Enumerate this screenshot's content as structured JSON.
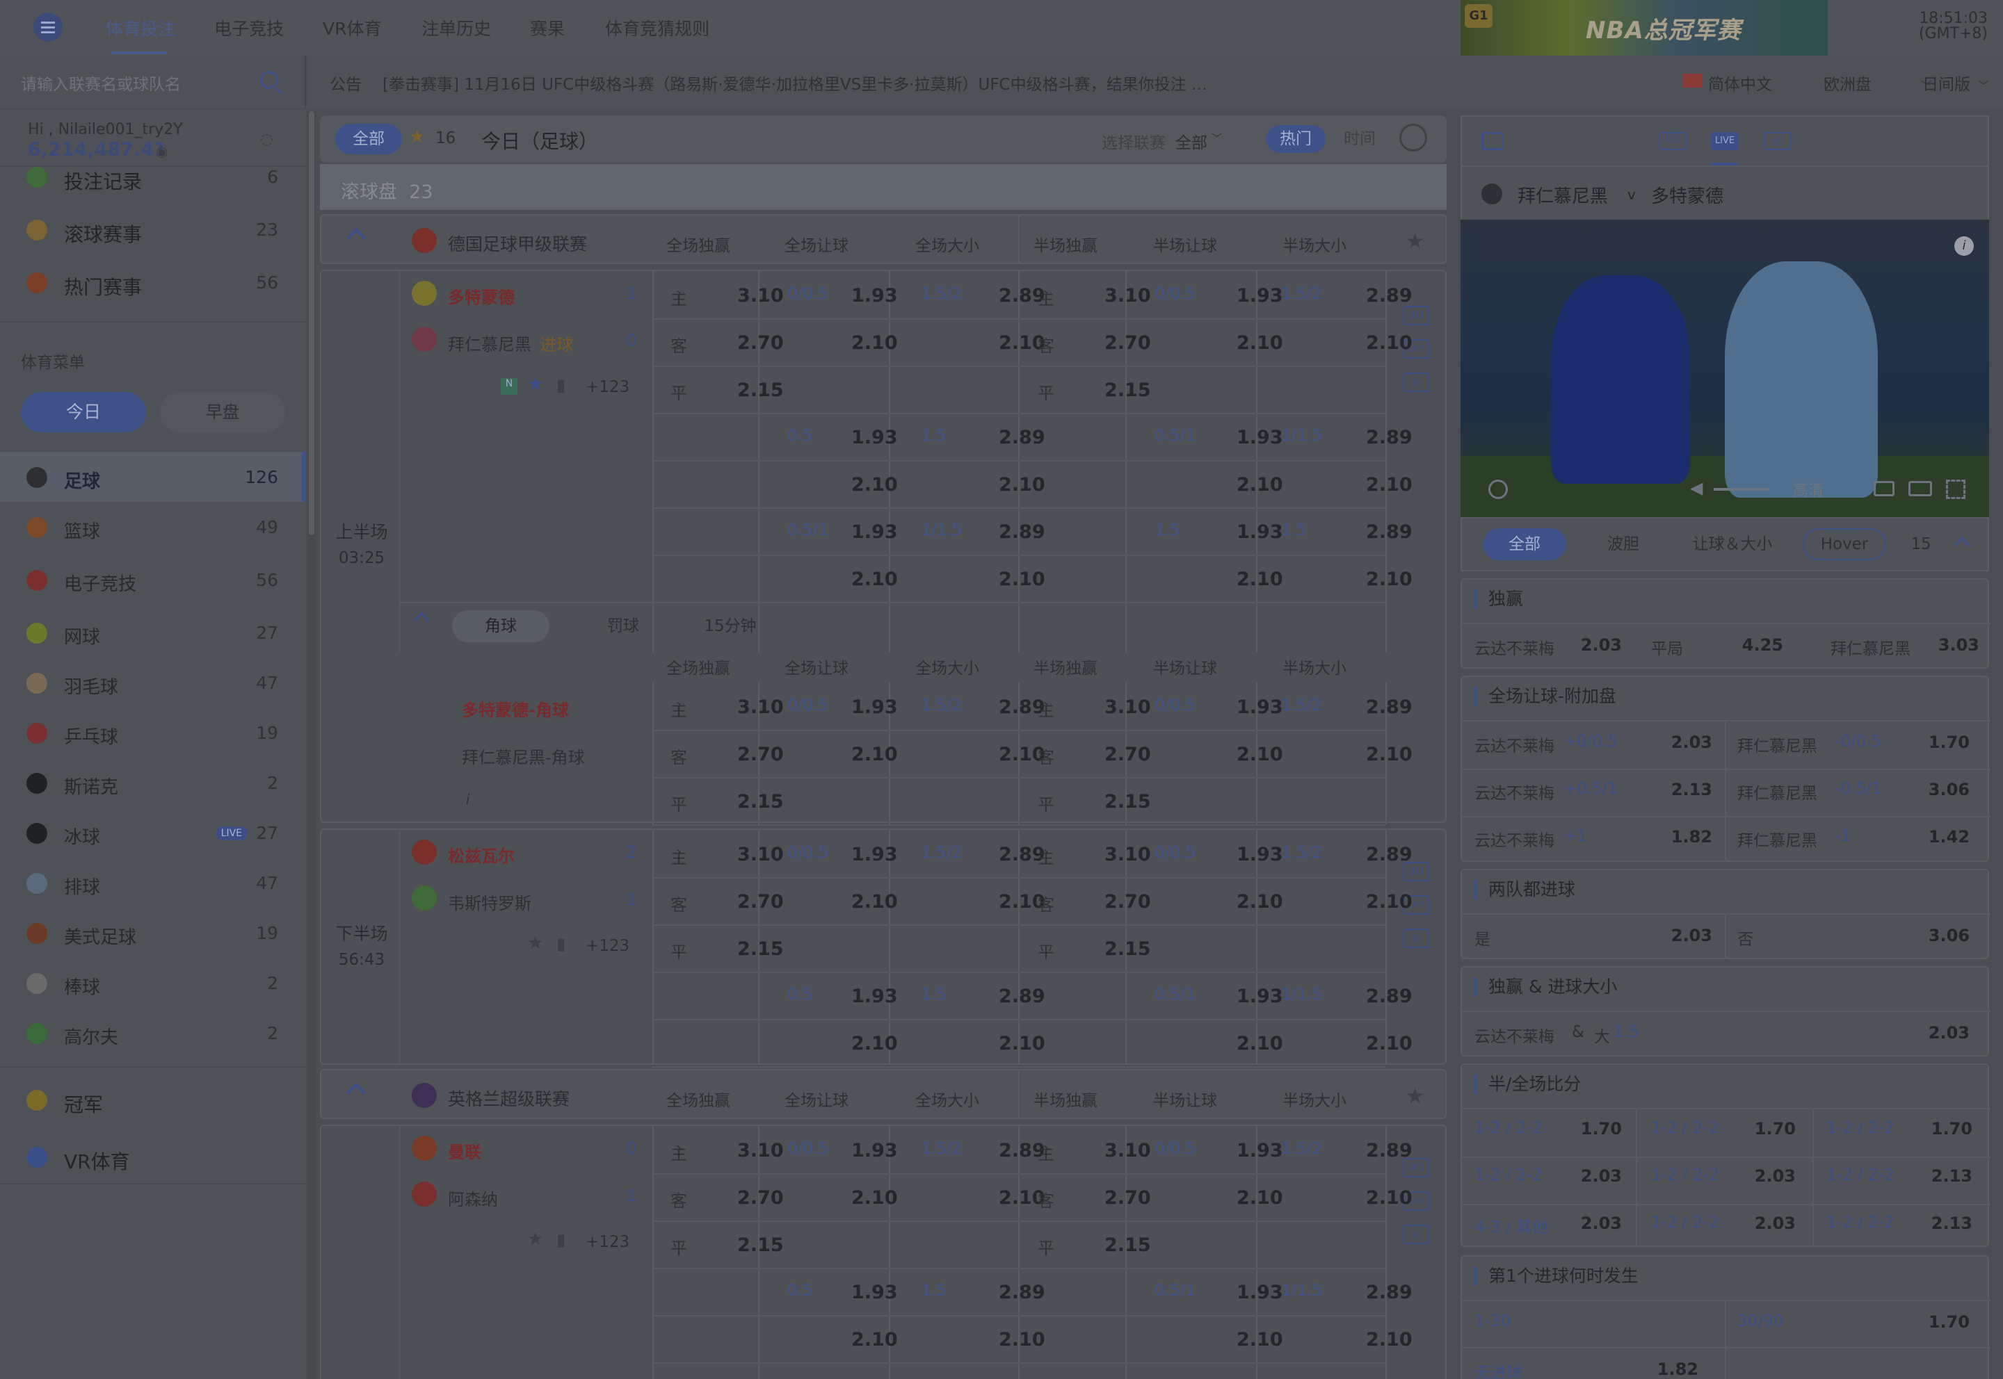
{
  "header": {
    "nav": [
      "体育投注",
      "电子竞技",
      "VR体育",
      "注单历史",
      "赛果",
      "体育竞猜规则"
    ],
    "banner_text": "NBA总冠军赛",
    "banner_badge": "G1",
    "time": "18:51:03",
    "timezone": "(GMT+8)"
  },
  "search": {
    "placeholder": "请输入联赛名或球队名"
  },
  "announcement": {
    "label": "公告",
    "text": "[拳击赛事] 11月16日 UFC中级格斗赛（路易斯·爱德华·加拉格里VS里卡多·拉莫斯）UFC中级格斗赛，结果你投注 …",
    "language": "简体中文",
    "odds_type": "欧洲盘",
    "theme": "日间版"
  },
  "user": {
    "greeting": "Hi , Nilaile001_try2Y",
    "balance": "6,214,487.41"
  },
  "sidebar": {
    "top": [
      {
        "label": "投注记录",
        "count": "6",
        "icon": "bet-record-icon",
        "color": "#3f6a3a"
      },
      {
        "label": "滚球赛事",
        "count": "23",
        "icon": "live-ball-icon",
        "color": "#7a6334"
      },
      {
        "label": "热门赛事",
        "count": "56",
        "icon": "fire-icon",
        "color": "#7a3e28"
      }
    ],
    "menu_title": "体育菜单",
    "toggle": [
      "今日",
      "早盘"
    ],
    "sports": [
      {
        "label": "足球",
        "count": "126",
        "icon": "soccer-icon",
        "color": "#2d2f33"
      },
      {
        "label": "篮球",
        "count": "49",
        "icon": "basketball-icon",
        "color": "#7a4a2a"
      },
      {
        "label": "电子竞技",
        "count": "56",
        "icon": "gamepad-icon",
        "color": "#7a2f2f"
      },
      {
        "label": "网球",
        "count": "27",
        "icon": "tennis-icon",
        "color": "#6b7a2a"
      },
      {
        "label": "羽毛球",
        "count": "47",
        "icon": "badminton-icon",
        "color": "#7a6a55"
      },
      {
        "label": "乒乓球",
        "count": "19",
        "icon": "pingpong-icon",
        "color": "#7a2f33"
      },
      {
        "label": "斯诺克",
        "count": "2",
        "icon": "snooker-icon",
        "color": "#1f2124"
      },
      {
        "label": "冰球",
        "count": "27",
        "icon": "hockey-icon",
        "color": "#1f2124",
        "badge": "LIVE"
      },
      {
        "label": "排球",
        "count": "47",
        "icon": "volleyball-icon",
        "color": "#5a6a7a"
      },
      {
        "label": "美式足球",
        "count": "19",
        "icon": "american-football-icon",
        "color": "#6a3a26"
      },
      {
        "label": "棒球",
        "count": "2",
        "icon": "baseball-icon",
        "color": "#6a6a6a"
      },
      {
        "label": "高尔夫",
        "count": "2",
        "icon": "golf-icon",
        "color": "#3a6a3a"
      }
    ],
    "bottom": [
      {
        "label": "冠军",
        "icon": "trophy-icon",
        "color": "#7a6a2a"
      },
      {
        "label": "VR体育",
        "icon": "vr-icon",
        "color": "#3a4e88"
      }
    ]
  },
  "filter": {
    "all": "全部",
    "fav_count": "16",
    "title": "今日（足球）",
    "league_label": "选择联赛",
    "league_value": "全部",
    "hot": "热门",
    "time": "时间"
  },
  "rolling": {
    "label": "滚球盘",
    "count": "23"
  },
  "columns": [
    "全场独赢",
    "全场让球",
    "全场大小",
    "半场独赢",
    "半场让球",
    "半场大小"
  ],
  "leagues": [
    {
      "name": "德国足球甲级联赛",
      "match": {
        "period": "上半场",
        "clock": "03:25",
        "home": "多特蒙德",
        "home_score": "1",
        "away": "拜仁慕尼黑",
        "away_score": "0",
        "away_note": "进球",
        "more": "+123",
        "rows": [
          [
            "主",
            "3.10",
            "0/0.5",
            "1.93",
            "1.5/2",
            "2.89",
            "主",
            "3.10",
            "0/0.5",
            "1.93",
            "1.5/2",
            "2.89"
          ],
          [
            "客",
            "2.70",
            "",
            "2.10",
            "",
            "2.10",
            "客",
            "2.70",
            "",
            "2.10",
            "",
            "2.10"
          ],
          [
            "平",
            "2.15",
            "",
            "",
            "",
            "",
            "平",
            "2.15",
            "",
            "",
            "",
            ""
          ],
          [
            "",
            "",
            "0.5",
            "1.93",
            "1.5",
            "2.89",
            "",
            "",
            "0.5/1",
            "1.93",
            "1/1.5",
            "2.89"
          ],
          [
            "",
            "",
            "",
            "2.10",
            "",
            "2.10",
            "",
            "",
            "",
            "2.10",
            "",
            "2.10"
          ],
          [
            "",
            "",
            "0.5/1",
            "1.93",
            "1/1.5",
            "2.89",
            "",
            "",
            "1.5",
            "1.93",
            "1.5",
            "2.89"
          ],
          [
            "",
            "",
            "",
            "2.10",
            "",
            "2.10",
            "",
            "",
            "",
            "2.10",
            "",
            "2.10"
          ]
        ],
        "subtabs": [
          "角球",
          "罚球",
          "15分钟"
        ],
        "corner_home": "多特蒙德-角球",
        "corner_away": "拜仁慕尼黑-角球",
        "corner_rows": [
          [
            "主",
            "3.10",
            "0/0.5",
            "1.93",
            "1.5/2",
            "2.89",
            "主",
            "3.10",
            "0/0.5",
            "1.93",
            "1.5/2",
            "2.89"
          ],
          [
            "客",
            "2.70",
            "",
            "2.10",
            "",
            "2.10",
            "客",
            "2.70",
            "",
            "2.10",
            "",
            "2.10"
          ],
          [
            "平",
            "2.15",
            "",
            "",
            "",
            "",
            "平",
            "2.15",
            "",
            "",
            "",
            ""
          ]
        ]
      },
      "match2": {
        "period": "下半场",
        "clock": "56:43",
        "home": "松兹瓦尔",
        "home_score": "2",
        "away": "韦斯特罗斯",
        "away_score": "1",
        "more": "+123",
        "rows": [
          [
            "主",
            "3.10",
            "0/0.5",
            "1.93",
            "1.5/2",
            "2.89",
            "主",
            "3.10",
            "0/0.5",
            "1.93",
            "1.5/2",
            "2.89"
          ],
          [
            "客",
            "2.70",
            "",
            "2.10",
            "",
            "2.10",
            "客",
            "2.70",
            "",
            "2.10",
            "",
            "2.10"
          ],
          [
            "平",
            "2.15",
            "",
            "",
            "",
            "",
            "平",
            "2.15",
            "",
            "",
            "",
            ""
          ],
          [
            "",
            "",
            "0.5",
            "1.93",
            "1.5",
            "2.89",
            "",
            "",
            "0.5/1",
            "1.93",
            "1/1.5",
            "2.89"
          ],
          [
            "",
            "",
            "",
            "2.10",
            "",
            "2.10",
            "",
            "",
            "",
            "2.10",
            "",
            "2.10"
          ]
        ]
      }
    },
    {
      "name": "英格兰超级联赛",
      "match": {
        "home": "曼联",
        "home_score": "0",
        "away": "阿森纳",
        "away_score": "1",
        "more": "+123",
        "rows": [
          [
            "主",
            "3.10",
            "0/0.5",
            "1.93",
            "1.5/2",
            "2.89",
            "主",
            "3.10",
            "0/0.5",
            "1.93",
            "1.5/2",
            "2.89"
          ],
          [
            "客",
            "2.70",
            "",
            "2.10",
            "",
            "2.10",
            "客",
            "2.70",
            "",
            "2.10",
            "",
            "2.10"
          ],
          [
            "平",
            "2.15",
            "",
            "",
            "",
            "",
            "平",
            "2.15",
            "",
            "",
            "",
            ""
          ],
          [
            "",
            "",
            "0.5",
            "1.93",
            "1.5",
            "2.89",
            "",
            "",
            "0.5/1",
            "1.93",
            "1/1.5",
            "2.89"
          ],
          [
            "",
            "",
            "",
            "2.10",
            "",
            "2.10",
            "",
            "",
            "",
            "2.10",
            "",
            "2.10"
          ]
        ]
      }
    }
  ],
  "right": {
    "match_home": "拜仁慕尼黑",
    "match_away": "多特蒙德",
    "vs": "v",
    "video_quality": "高清",
    "tabs": [
      "全部",
      "波胆",
      "让球＆大小",
      "Hover",
      "15"
    ],
    "cards": {
      "c1": {
        "title": "独赢",
        "items": [
          [
            "云达不莱梅",
            "2.03"
          ],
          [
            "平局",
            "4.25"
          ],
          [
            "拜仁慕尼黑",
            "3.03"
          ]
        ]
      },
      "c2": {
        "title": "全场让球-附加盘",
        "rows": [
          [
            "云达不莱梅",
            "+0/0.5",
            "2.03",
            "拜仁慕尼黑",
            "-0/0.5",
            "1.70"
          ],
          [
            "云达不莱梅",
            "+0.5/1",
            "2.13",
            "拜仁慕尼黑",
            "-0.5/1",
            "3.06"
          ],
          [
            "云达不莱梅",
            "+1",
            "1.82",
            "拜仁慕尼黑",
            "-1",
            "1.42"
          ]
        ]
      },
      "c3": {
        "title": "两队都进球",
        "items": [
          [
            "是",
            "2.03"
          ],
          [
            "否",
            "3.06"
          ]
        ]
      },
      "c4": {
        "title": "独赢 & 进球大小",
        "label": "云达不莱梅",
        "amp": "&",
        "size": "大",
        "line": "1.5",
        "value": "2.03"
      },
      "c5": {
        "title": "半/全场比分",
        "rows": [
          [
            "1-2 / 2-2",
            "1.70",
            "1-2 / 2-2",
            "1.70",
            "1-2 / 2-2",
            "1.70"
          ],
          [
            "1-2 / 2-2",
            "2.03",
            "1-2 / 2-2",
            "2.03",
            "1-2 / 2-2",
            "2.13"
          ],
          [
            "4-3 / 其他",
            "2.03",
            "1-2 / 2-2",
            "2.03",
            "1-2 / 2-2",
            "2.13"
          ]
        ]
      },
      "c6": {
        "title": "第1个进球何时发生",
        "rows": [
          [
            "1-30",
            "",
            "30/90",
            "1.70"
          ],
          [
            "无进球",
            "1.82",
            "",
            ""
          ]
        ]
      }
    }
  }
}
